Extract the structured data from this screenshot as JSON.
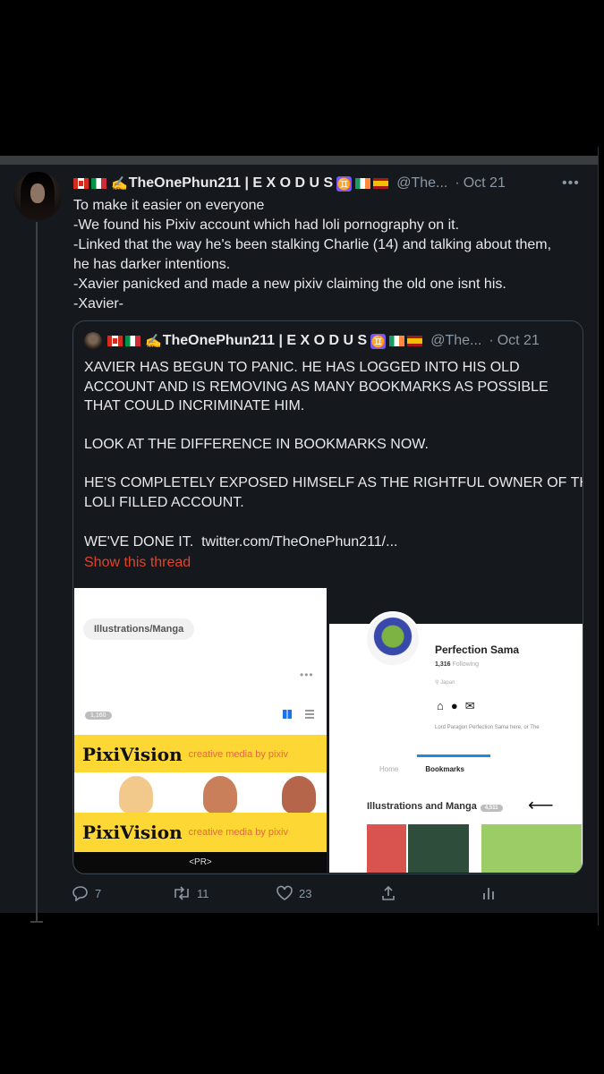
{
  "tweet": {
    "author": {
      "name": "TheOnePhun211 | E X O D U S",
      "handle": "@The...",
      "separator": "·",
      "date": "Oct 21",
      "gemini": "♊"
    },
    "more": "•••",
    "body_lines": [
      "To make it easier on everyone",
      "-We found his Pixiv account which had loli pornography on it.",
      "-Linked that the way he's been stalking Charlie (14) and talking about them,",
      "he has darker intentions.",
      "-Xavier panicked and made a new pixiv claiming the old one isnt his.",
      "-Xavier-"
    ]
  },
  "quote": {
    "author": {
      "name": "TheOnePhun211 | E X O D U S",
      "handle": "@The...",
      "separator": "·",
      "date": "Oct 21",
      "gemini": "♊"
    },
    "lines": [
      "XAVIER HAS BEGUN TO PANIC. HE HAS LOGGED INTO HIS OLD",
      "ACCOUNT AND IS REMOVING AS MANY BOOKMARKS AS POSSIBLE",
      "THAT COULD INCRIMINATE HIM.",
      "",
      "LOOK AT THE DIFFERENCE IN BOOKMARKS NOW.",
      "",
      "HE'S COMPLETELY EXPOSED HIMSELF AS THE RIGHTFUL OWNER OF THE",
      "LOLI FILLED ACCOUNT.",
      ""
    ],
    "last_line_prefix": "WE'VE DONE IT.",
    "link": "twitter.com/TheOnePhun211/...",
    "show_thread": "Show this thread"
  },
  "left_image": {
    "pill": "Illustrations/Manga",
    "ellipsis": "•••",
    "count": "1,160",
    "banner_logo": "PixiVision",
    "banner_tag": "creative media by pixiv",
    "pr": "<PR>"
  },
  "right_image": {
    "name": "Perfection Sama",
    "following_count": "1,316",
    "following_label": "Following",
    "location": "Japan",
    "bio": "Lord Paragon Perfection Sama here, or The",
    "tab_home": "Home",
    "tab_bookmarks": "Bookmarks",
    "heading": "Illustrations and Manga",
    "heading_count": "4,511",
    "arrow": "⟵"
  },
  "actions": {
    "replies": "7",
    "retweets": "11",
    "likes": "23"
  }
}
